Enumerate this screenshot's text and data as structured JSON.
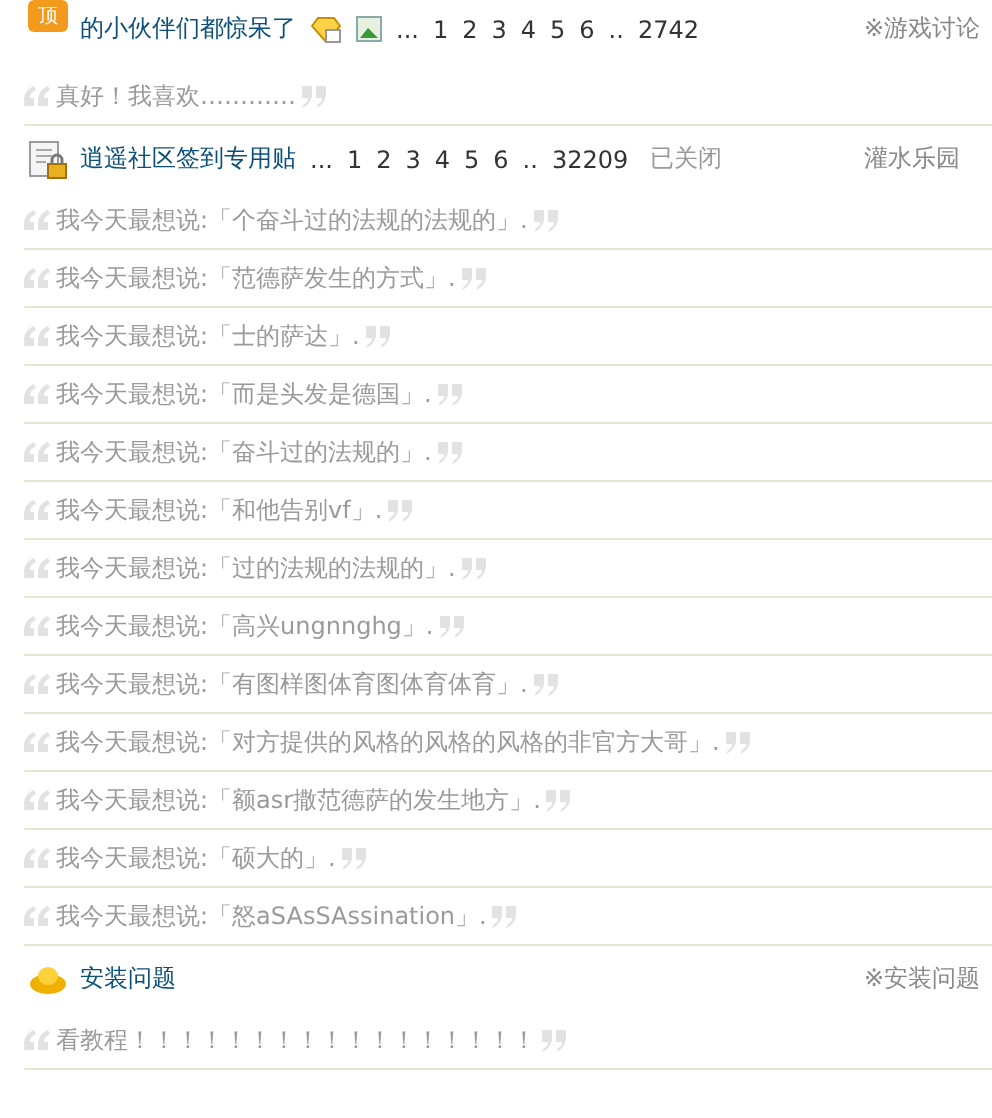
{
  "threads": [
    {
      "kind": "pinned_topic",
      "badge": "顶",
      "title": "的小伙伴们都惊呆了",
      "pages_lead": "...",
      "pages": [
        "1",
        "2",
        "3",
        "4",
        "5",
        "6"
      ],
      "pages_gap": "..",
      "last_page": "2742",
      "forum": "※游戏讨论"
    },
    {
      "kind": "quote",
      "text": "真好！我喜欢…………"
    },
    {
      "kind": "locked_topic",
      "title": "逍遥社区签到专用贴",
      "pages_lead": "...",
      "pages": [
        "1",
        "2",
        "3",
        "4",
        "5",
        "6"
      ],
      "pages_gap": "..",
      "last_page": "32209",
      "status": "已关闭",
      "forum": "灌水乐园"
    },
    {
      "kind": "quote",
      "text": "我今天最想说:「个奋斗过的法规的法规的」."
    },
    {
      "kind": "quote",
      "text": "我今天最想说:「范德萨发生的方式」."
    },
    {
      "kind": "quote",
      "text": "我今天最想说:「士的萨达」."
    },
    {
      "kind": "quote",
      "text": "我今天最想说:「而是头发是德国」."
    },
    {
      "kind": "quote",
      "text": "我今天最想说:「奋斗过的法规的」."
    },
    {
      "kind": "quote",
      "text": "我今天最想说:「和他告别vf」."
    },
    {
      "kind": "quote",
      "text": "我今天最想说:「过的法规的法规的」."
    },
    {
      "kind": "quote",
      "text": "我今天最想说:「高兴ungnnghg」."
    },
    {
      "kind": "quote",
      "text": "我今天最想说:「有图样图体育图体育体育」."
    },
    {
      "kind": "quote",
      "text": "我今天最想说:「对方提供的风格的风格的风格的非官方大哥」."
    },
    {
      "kind": "quote",
      "text": "我今天最想说:「额asr撒范德萨的发生地方」."
    },
    {
      "kind": "quote",
      "text": "我今天最想说:「硕大的」."
    },
    {
      "kind": "quote",
      "text": "我今天最想说:「怒aSAsSAssination」."
    },
    {
      "kind": "topic",
      "title": "安装问题",
      "forum": "※安装问题"
    },
    {
      "kind": "quote",
      "text": "看教程！！！！！！！！！！！！！！！！！"
    }
  ]
}
